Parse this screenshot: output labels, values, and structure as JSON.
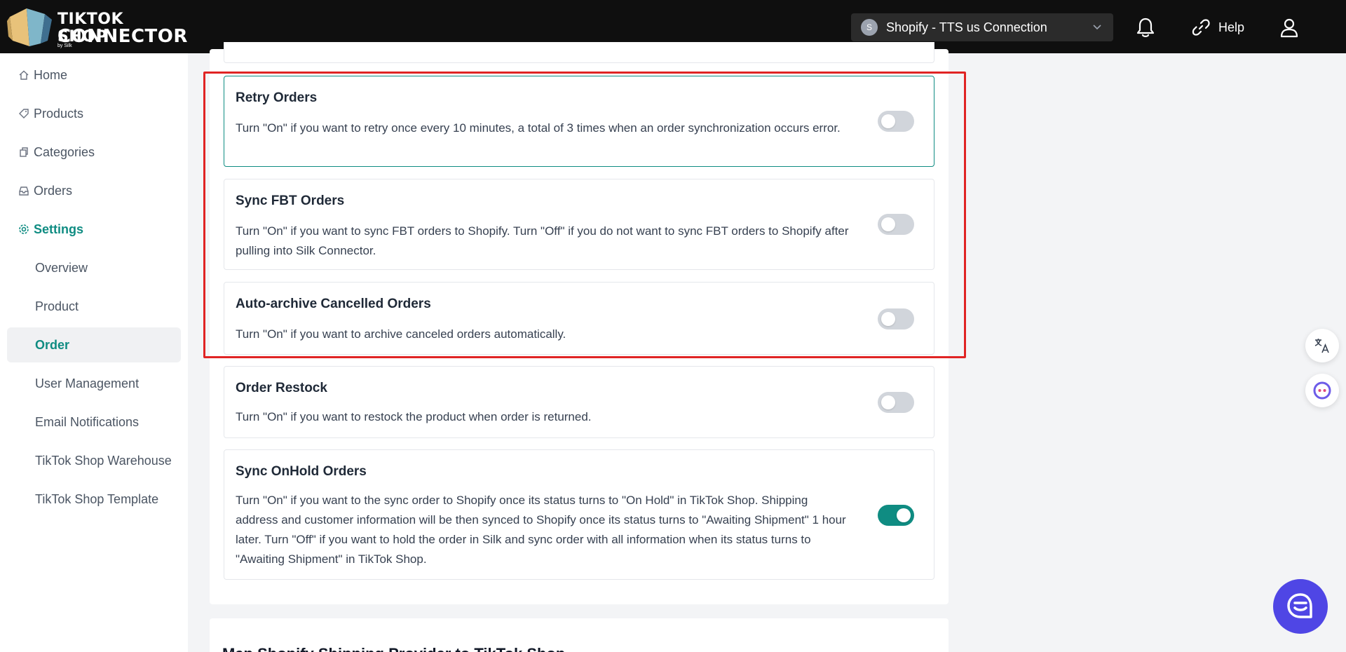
{
  "header": {
    "logo_line1": "TIKTOK SHOP",
    "logo_line2": "CONNECTOR",
    "logo_by": "by Silk",
    "store_initial": "S",
    "store_name": "Shopify - TTS us Connection",
    "help_label": "Help"
  },
  "sidebar": {
    "items": [
      {
        "label": "Home",
        "icon": "home-icon"
      },
      {
        "label": "Products",
        "icon": "tag-icon"
      },
      {
        "label": "Categories",
        "icon": "copy-icon"
      },
      {
        "label": "Orders",
        "icon": "inbox-icon"
      },
      {
        "label": "Settings",
        "icon": "gear-icon"
      }
    ],
    "sub_items": [
      {
        "label": "Overview"
      },
      {
        "label": "Product"
      },
      {
        "label": "Order"
      },
      {
        "label": "User Management"
      },
      {
        "label": "Email Notifications"
      },
      {
        "label": "TikTok Shop Warehouse"
      },
      {
        "label": "TikTok Shop Template"
      }
    ]
  },
  "settings": [
    {
      "title": "Retry Orders",
      "description": "Turn \"On\" if you want to retry once every 10 minutes, a total of 3 times when an order synchronization occurs error.",
      "enabled": false
    },
    {
      "title": "Sync FBT Orders",
      "description": "Turn \"On\" if you want to sync FBT orders to Shopify. Turn \"Off\" if you do not want to sync FBT orders to Shopify after pulling into Silk Connector.",
      "enabled": false
    },
    {
      "title": "Auto-archive Cancelled Orders",
      "description": "Turn \"On\" if you want to archive canceled orders automatically.",
      "enabled": false
    },
    {
      "title": "Order Restock",
      "description": "Turn \"On\" if you want to restock the product when order is returned.",
      "enabled": false
    },
    {
      "title": "Sync OnHold Orders",
      "description": "Turn \"On\" if you want to the sync order to Shopify once its status turns to \"On Hold\" in TikTok Shop. Shipping address and customer information will be then synced to Shopify once its status turns to \"Awaiting Shipment\" 1 hour later. Turn \"Off\" if you want to hold the order in Silk and sync order with all information when its status turns to \"Awaiting Shipment\" in TikTok Shop.",
      "enabled": true
    }
  ],
  "next_section_title": "Map Shopify Shipping Provider to TikTok Shop",
  "colors": {
    "accent": "#0f8c82",
    "highlight": "#e02424",
    "topbar": "#0f0f0f",
    "chat": "#4f46e5"
  }
}
